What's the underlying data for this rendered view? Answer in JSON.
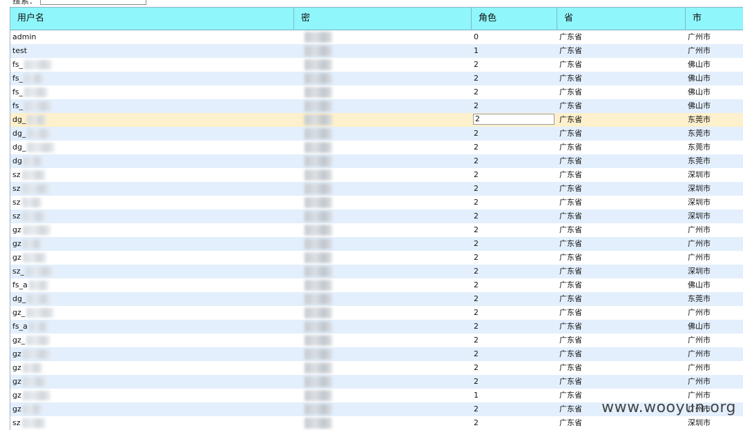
{
  "search": {
    "label": "搜索：",
    "value": ""
  },
  "columns": [
    "用户名",
    "密",
    "角色",
    "省",
    "市"
  ],
  "rows": [
    {
      "user": "admin",
      "role": "0",
      "province": "广东省",
      "city": "广州市"
    },
    {
      "user": "test",
      "role": "1",
      "province": "广东省",
      "city": "广州市"
    },
    {
      "user": "fs_",
      "role": "2",
      "province": "广东省",
      "city": "佛山市"
    },
    {
      "user": "fs_",
      "role": "2",
      "province": "广东省",
      "city": "佛山市"
    },
    {
      "user": "fs_",
      "role": "2",
      "province": "广东省",
      "city": "佛山市"
    },
    {
      "user": "fs_",
      "role": "2",
      "province": "广东省",
      "city": "佛山市"
    },
    {
      "user": "dg_",
      "role": "2",
      "province": "广东省",
      "city": "东莞市",
      "selected": true
    },
    {
      "user": "dg_",
      "role": "2",
      "province": "广东省",
      "city": "东莞市"
    },
    {
      "user": "dg_",
      "role": "2",
      "province": "广东省",
      "city": "东莞市"
    },
    {
      "user": "dg",
      "role": "2",
      "province": "广东省",
      "city": "东莞市"
    },
    {
      "user": "sz",
      "role": "2",
      "province": "广东省",
      "city": "深圳市"
    },
    {
      "user": "sz",
      "role": "2",
      "province": "广东省",
      "city": "深圳市"
    },
    {
      "user": "sz",
      "role": "2",
      "province": "广东省",
      "city": "深圳市"
    },
    {
      "user": "sz",
      "role": "2",
      "province": "广东省",
      "city": "深圳市"
    },
    {
      "user": "gz",
      "role": "2",
      "province": "广东省",
      "city": "广州市"
    },
    {
      "user": "gz",
      "role": "2",
      "province": "广东省",
      "city": "广州市"
    },
    {
      "user": "gz",
      "role": "2",
      "province": "广东省",
      "city": "广州市"
    },
    {
      "user": "sz_",
      "role": "2",
      "province": "广东省",
      "city": "深圳市"
    },
    {
      "user": "fs_a",
      "role": "2",
      "province": "广东省",
      "city": "佛山市"
    },
    {
      "user": "dg_",
      "role": "2",
      "province": "广东省",
      "city": "东莞市"
    },
    {
      "user": "gz_",
      "role": "2",
      "province": "广东省",
      "city": "广州市"
    },
    {
      "user": "fs_a",
      "role": "2",
      "province": "广东省",
      "city": "佛山市"
    },
    {
      "user": "gz_",
      "role": "2",
      "province": "广东省",
      "city": "广州市"
    },
    {
      "user": "gz",
      "role": "2",
      "province": "广东省",
      "city": "广州市"
    },
    {
      "user": "gz",
      "role": "2",
      "province": "广东省",
      "city": "广州市"
    },
    {
      "user": "gz",
      "role": "2",
      "province": "广东省",
      "city": "广州市"
    },
    {
      "user": "gz",
      "role": "1",
      "province": "广东省",
      "city": "广州市"
    },
    {
      "user": "gz",
      "role": "2",
      "province": "广东省",
      "city": "广州市"
    },
    {
      "user": "sz",
      "role": "2",
      "province": "广东省",
      "city": "深圳市"
    }
  ],
  "watermark": "www.wooyun.org"
}
